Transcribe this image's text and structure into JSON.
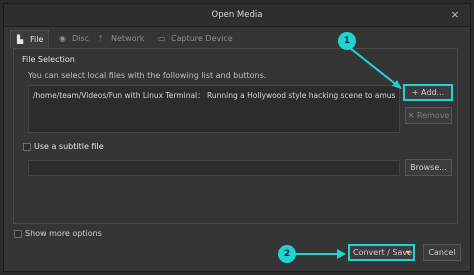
{
  "window": {
    "title": "Open Media",
    "close_icon": "×"
  },
  "tabs": [
    {
      "label": "File",
      "icon": "file-icon"
    },
    {
      "label": "Disc",
      "icon": "disc-icon"
    },
    {
      "label": "Network",
      "icon": "network-icon"
    },
    {
      "label": "Capture Device",
      "icon": "capture-device-icon"
    }
  ],
  "file_selection": {
    "title": "File Selection",
    "description": "You can select local files with the following list and buttons.",
    "files": [
      "/home/team/Videos/Fun with Linux Terminal： Running a Hollywood style hacking scene to amuse your fri..."
    ],
    "add_label": "+ Add...",
    "remove_label": "✕ Remove"
  },
  "subtitle": {
    "label": "Use a subtitle file",
    "browse_label": "Browse..."
  },
  "footer": {
    "show_more_label": "Show more options",
    "convert_label": "Convert / Save",
    "dropdown_arrow": "▾",
    "cancel_label": "Cancel"
  },
  "callouts": {
    "one": "1",
    "two": "2"
  },
  "colors": {
    "highlight": "#1fd3d3",
    "background": "#353535"
  }
}
